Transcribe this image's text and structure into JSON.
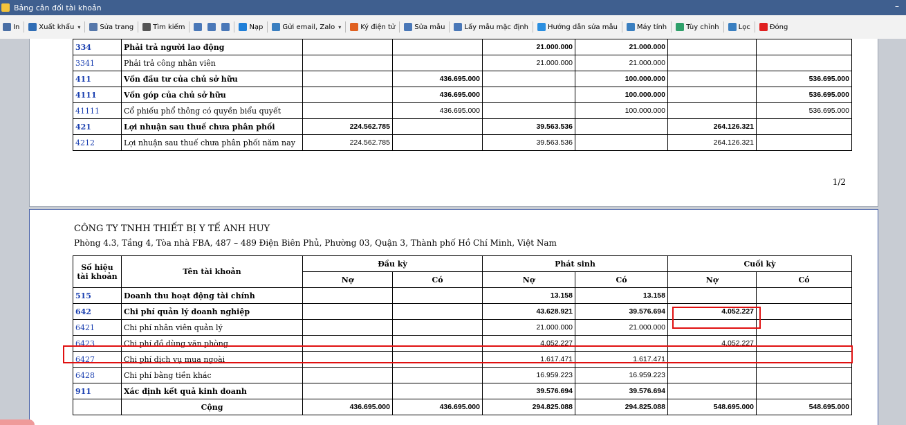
{
  "window": {
    "title": "Bảng cân đối tài khoản"
  },
  "toolbar": {
    "items": [
      {
        "label": "In",
        "icon": "printer-icon",
        "color": "#4a6fa5"
      },
      {
        "label": "Xuất khẩu",
        "icon": "save-icon",
        "color": "#2f6db5",
        "dropdown": true
      },
      {
        "label": "Sửa trang",
        "icon": "edit-page-icon",
        "color": "#5577aa"
      },
      {
        "label": "Tìm kiếm",
        "icon": "binoculars-icon",
        "color": "#555555"
      },
      {
        "label": "",
        "icon": "view-single-icon",
        "color": "#4a78b8"
      },
      {
        "label": "",
        "icon": "view-double-icon",
        "color": "#4a78b8"
      },
      {
        "label": "",
        "icon": "view-fit-icon",
        "color": "#4a78b8"
      },
      {
        "label": "Nạp",
        "icon": "refresh-icon",
        "color": "#1f7fd8"
      },
      {
        "label": "Gửi email, Zalo",
        "icon": "send-icon",
        "color": "#3a7fc0",
        "dropdown": true
      },
      {
        "label": "Ký điện tử",
        "icon": "signature-icon",
        "color": "#e06020"
      },
      {
        "label": "Sửa mẫu",
        "icon": "template-edit-icon",
        "color": "#4a78b8"
      },
      {
        "label": "Lấy mẫu mặc định",
        "icon": "template-default-icon",
        "color": "#4a78b8"
      },
      {
        "label": "Hướng dẫn sửa mẫu",
        "icon": "help-icon",
        "color": "#2b8fe0"
      },
      {
        "label": "Máy tính",
        "icon": "calculator-icon",
        "color": "#3a7fc0"
      },
      {
        "label": "Tùy chỉnh",
        "icon": "customize-icon",
        "color": "#2fa06a"
      },
      {
        "label": "Lọc",
        "icon": "filter-icon",
        "color": "#3a7fc0"
      },
      {
        "label": "Đóng",
        "icon": "close-circle-icon",
        "color": "#e02020"
      }
    ]
  },
  "page1": {
    "rows": [
      {
        "code": "334",
        "name": "Phải trả người lao động",
        "bold": true,
        "dk_no": "",
        "dk_co": "",
        "ps_no": "21.000.000",
        "ps_co": "21.000.000",
        "ck_no": "",
        "ck_co": ""
      },
      {
        "code": "3341",
        "name": "Phải trả công nhân viên",
        "bold": false,
        "dk_no": "",
        "dk_co": "",
        "ps_no": "21.000.000",
        "ps_co": "21.000.000",
        "ck_no": "",
        "ck_co": ""
      },
      {
        "code": "411",
        "name": "Vốn đầu tư của chủ sở hữu",
        "bold": true,
        "dk_no": "",
        "dk_co": "436.695.000",
        "ps_no": "",
        "ps_co": "100.000.000",
        "ck_no": "",
        "ck_co": "536.695.000"
      },
      {
        "code": "4111",
        "name": "Vốn góp của chủ sở hữu",
        "bold": true,
        "dk_no": "",
        "dk_co": "436.695.000",
        "ps_no": "",
        "ps_co": "100.000.000",
        "ck_no": "",
        "ck_co": "536.695.000"
      },
      {
        "code": "41111",
        "name": "Cổ phiếu phổ thông có quyền biểu quyết",
        "bold": false,
        "dk_no": "",
        "dk_co": "436.695.000",
        "ps_no": "",
        "ps_co": "100.000.000",
        "ck_no": "",
        "ck_co": "536.695.000"
      },
      {
        "code": "421",
        "name": "Lợi nhuận sau thuế chưa phân phối",
        "bold": true,
        "dk_no": "224.562.785",
        "dk_co": "",
        "ps_no": "39.563.536",
        "ps_co": "",
        "ck_no": "264.126.321",
        "ck_co": ""
      },
      {
        "code": "4212",
        "name": "Lợi nhuận sau thuế chưa phân phối năm nay",
        "bold": false,
        "dk_no": "224.562.785",
        "dk_co": "",
        "ps_no": "39.563.536",
        "ps_co": "",
        "ck_no": "264.126.321",
        "ck_co": ""
      }
    ],
    "page_number": "1/2"
  },
  "page2": {
    "company": "CÔNG TY TNHH THIẾT BỊ Y TẾ ANH HUY",
    "address": "Phòng 4.3, Tầng 4, Tòa nhà FBA, 487 – 489 Điện Biên Phủ, Phường 03, Quận 3, Thành phố Hồ Chí Minh, Việt Nam",
    "headers": {
      "code": "Số hiệu tài khoản",
      "name": "Tên tài khoản",
      "dau_ky": "Đầu kỳ",
      "phat_sinh": "Phát sinh",
      "cuoi_ky": "Cuối kỳ",
      "no": "Nợ",
      "co": "Có"
    },
    "rows": [
      {
        "code": "515",
        "name": "Doanh thu hoạt động tài chính",
        "bold": true,
        "dk_no": "",
        "dk_co": "",
        "ps_no": "13.158",
        "ps_co": "13.158",
        "ck_no": "",
        "ck_co": ""
      },
      {
        "code": "642",
        "name": "Chi phí quản lý doanh nghiệp",
        "bold": true,
        "dk_no": "",
        "dk_co": "",
        "ps_no": "43.628.921",
        "ps_co": "39.576.694",
        "ck_no": "4.052.227",
        "ck_co": ""
      },
      {
        "code": "6421",
        "name": "Chi phí nhân viên quản lý",
        "bold": false,
        "dk_no": "",
        "dk_co": "",
        "ps_no": "21.000.000",
        "ps_co": "21.000.000",
        "ck_no": "",
        "ck_co": ""
      },
      {
        "code": "6423",
        "name": "Chi phí đồ dùng văn phòng",
        "bold": false,
        "dk_no": "",
        "dk_co": "",
        "ps_no": "4.052.227",
        "ps_co": "",
        "ck_no": "4.052.227",
        "ck_co": ""
      },
      {
        "code": "6427",
        "name": "Chi phí dịch vụ mua ngoài",
        "bold": false,
        "dk_no": "",
        "dk_co": "",
        "ps_no": "1.617.471",
        "ps_co": "1.617.471",
        "ck_no": "",
        "ck_co": ""
      },
      {
        "code": "6428",
        "name": "Chi phí bằng tiền khác",
        "bold": false,
        "dk_no": "",
        "dk_co": "",
        "ps_no": "16.959.223",
        "ps_co": "16.959.223",
        "ck_no": "",
        "ck_co": ""
      },
      {
        "code": "911",
        "name": "Xác định kết quả kinh doanh",
        "bold": true,
        "dk_no": "",
        "dk_co": "",
        "ps_no": "39.576.694",
        "ps_co": "39.576.694",
        "ck_no": "",
        "ck_co": ""
      },
      {
        "code": "",
        "name": "Cộng",
        "bold": true,
        "total": true,
        "dk_no": "436.695.000",
        "dk_co": "436.695.000",
        "ps_no": "294.825.088",
        "ps_co": "294.825.088",
        "ck_no": "548.695.000",
        "ck_co": "548.695.000"
      }
    ]
  },
  "highlight_color": "#e01010"
}
